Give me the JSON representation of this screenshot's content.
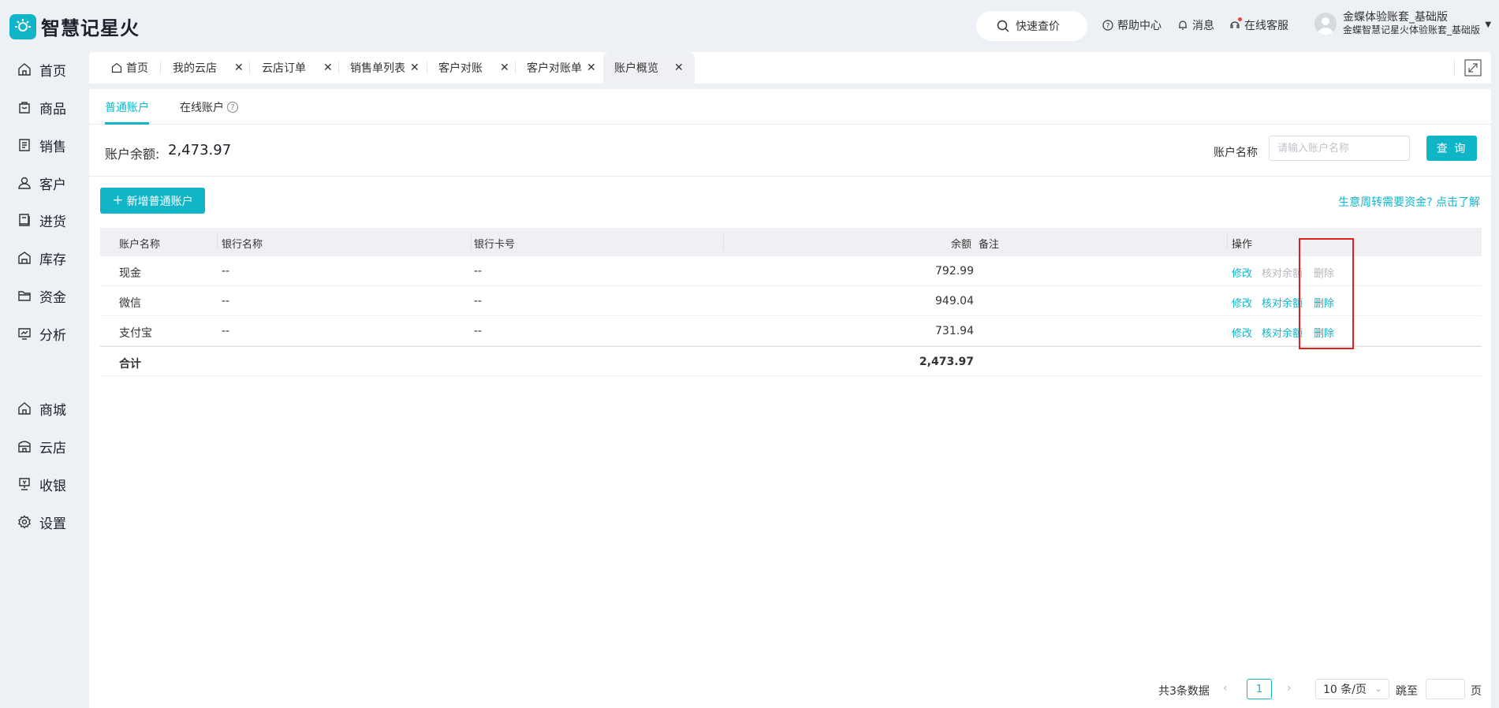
{
  "app": {
    "logo_text": "智慧记星火",
    "logo_icon": "sun-logo-icon"
  },
  "header": {
    "quick_price": "快速查价",
    "help": "帮助中心",
    "messages": "消息",
    "online_service": "在线客服",
    "user_name": "金蝶体验账套_基础版",
    "user_sub": "金蝶智慧记星火体验账套_基础版"
  },
  "sidebar": {
    "items": [
      {
        "label": "首页",
        "icon": "home-icon"
      },
      {
        "label": "商品",
        "icon": "bag-icon"
      },
      {
        "label": "销售",
        "icon": "receipt-icon"
      },
      {
        "label": "客户",
        "icon": "user-icon"
      },
      {
        "label": "进货",
        "icon": "book-icon"
      },
      {
        "label": "库存",
        "icon": "warehouse-icon"
      },
      {
        "label": "资金",
        "icon": "folder-icon"
      },
      {
        "label": "分析",
        "icon": "chart-icon"
      },
      {
        "label": "商城",
        "icon": "shop-icon"
      },
      {
        "label": "云店",
        "icon": "store-icon"
      },
      {
        "label": "收银",
        "icon": "cashier-icon"
      },
      {
        "label": "设置",
        "icon": "gear-icon"
      }
    ]
  },
  "tabs": [
    {
      "label": "首页"
    },
    {
      "label": "我的云店"
    },
    {
      "label": "云店订单"
    },
    {
      "label": "销售单列表"
    },
    {
      "label": "客户对账"
    },
    {
      "label": "客户对账单"
    },
    {
      "label": "账户概览"
    }
  ],
  "subtabs": {
    "normal": "普通账户",
    "online": "在线账户",
    "online_help": "?"
  },
  "balance": {
    "label": "账户余额:",
    "value": "2,473.97"
  },
  "search": {
    "label": "账户名称",
    "placeholder": "请输入账户名称",
    "button": "查 询"
  },
  "actions": {
    "add_button": "新增普通账户",
    "promo_link": "生意周转需要资金? 点击了解"
  },
  "table": {
    "headers": {
      "name": "账户名称",
      "bank": "银行名称",
      "card": "银行卡号",
      "balance": "余额",
      "note": "备注",
      "ops": "操作"
    },
    "rows": [
      {
        "name": "现金",
        "bank": "--",
        "card": "--",
        "balance": "792.99",
        "note": "",
        "edit": "修改",
        "check": "核对余额",
        "delete": "删除"
      },
      {
        "name": "微信",
        "bank": "--",
        "card": "--",
        "balance": "949.04",
        "note": "",
        "edit": "修改",
        "check": "核对余额",
        "delete": "删除"
      },
      {
        "name": "支付宝",
        "bank": "--",
        "card": "--",
        "balance": "731.94",
        "note": "",
        "edit": "修改",
        "check": "核对余额",
        "delete": "删除"
      }
    ],
    "total": {
      "label": "合计",
      "balance": "2,473.97"
    }
  },
  "pagination": {
    "total": "共3条数据",
    "current": "1",
    "page_size": "10 条/页",
    "goto": "跳至",
    "unit": "页"
  },
  "colors": {
    "accent": "#10b5c8",
    "highlight": "#e02020",
    "disabled": "#b5b8bd"
  }
}
